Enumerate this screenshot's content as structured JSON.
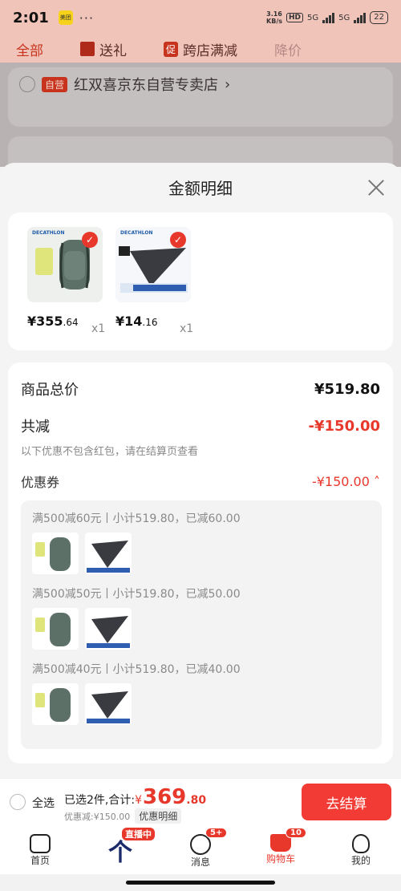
{
  "status": {
    "time": "2:01",
    "app_badge": "美团",
    "dots": "···",
    "speed_top": "3.16",
    "speed_bottom": "KB/s",
    "hd": "HD",
    "net1": "5G",
    "net2": "5G",
    "battery": "22"
  },
  "bg_tabs": {
    "all": "全部",
    "gift": "送礼",
    "cu": "促",
    "cross": "跨店满减",
    "drop": "降价"
  },
  "bg_store": {
    "tag": "自营",
    "name": "红双喜京东自营专卖店",
    "arrow": "›"
  },
  "sheet": {
    "title": "金额明细",
    "products": [
      {
        "brand": "DECATHLON",
        "price_int": "¥355",
        "price_dec": ".64",
        "qty": "x1"
      },
      {
        "brand": "DECATHLON",
        "price_int": "¥14",
        "price_dec": ".16",
        "qty": "x1"
      }
    ],
    "total_label": "商品总价",
    "total_value": "¥519.80",
    "reduce_label": "共减",
    "reduce_value": "-¥150.00",
    "note": "以下优惠不包含红包，请在结算页查看",
    "coupon_label": "优惠券",
    "coupon_value": "-¥150.00",
    "coupon_arrow": "˄",
    "coupon_lines": [
      "满500减60元丨小计519.80，已减60.00",
      "满500减50元丨小计519.80，已减50.00",
      "满500减40元丨小计519.80，已减40.00"
    ]
  },
  "checkout": {
    "select_all": "全选",
    "selected": "已选2件,合计:",
    "yen": "¥",
    "amount_int": "369",
    "amount_dec": ".80",
    "discount": "优惠减:¥150.00",
    "detail": "优惠明细",
    "submit": "去结算"
  },
  "nav": {
    "home": "首页",
    "live": "直播中",
    "live_logo": "个",
    "msg": "消息",
    "msg_badge": "5+",
    "cart": "购物车",
    "cart_badge": "10",
    "me": "我的"
  }
}
